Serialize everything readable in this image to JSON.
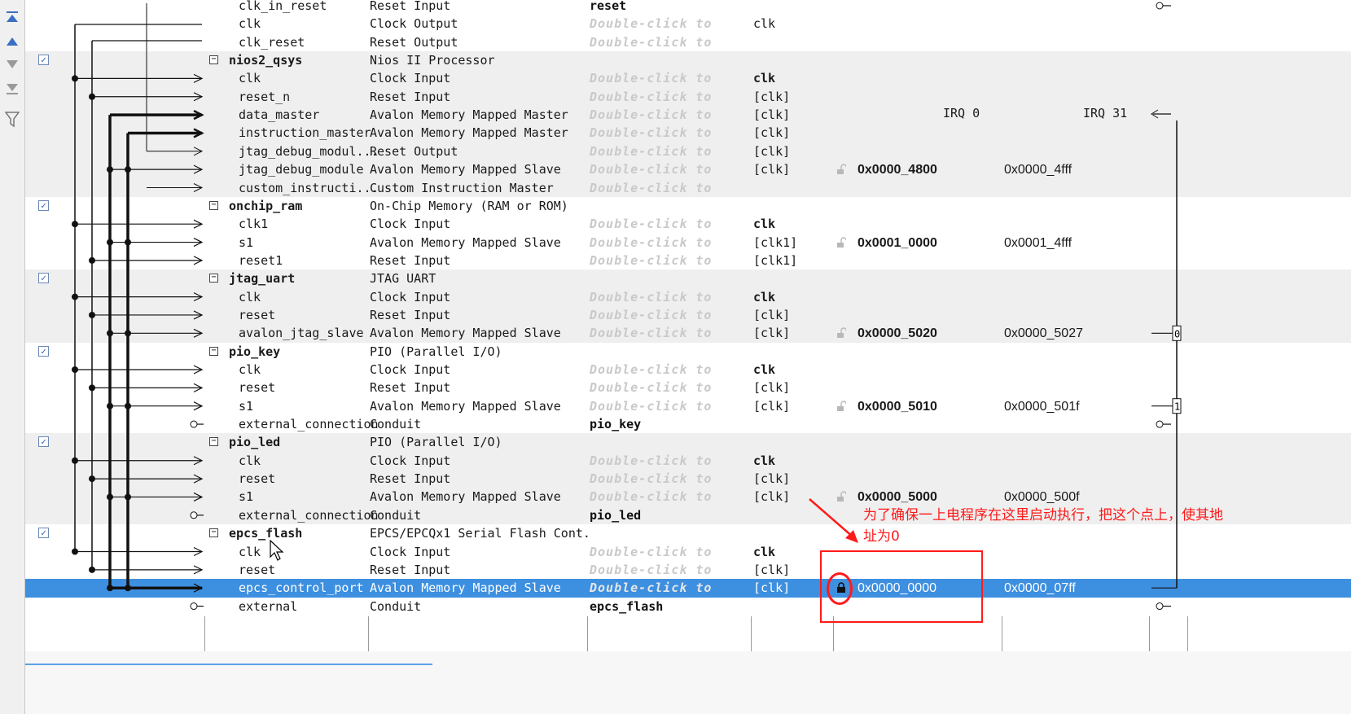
{
  "toolbar": {
    "buttons": [
      {
        "icon": "move-to-top-icon"
      },
      {
        "icon": "move-up-icon"
      },
      {
        "icon": "move-down-icon"
      },
      {
        "icon": "move-to-bottom-icon"
      },
      {
        "icon": "filter-icon"
      }
    ]
  },
  "irq": {
    "label_start": "IRQ 0",
    "label_end": "IRQ 31"
  },
  "rows": [
    {
      "name": "clk_in_reset",
      "desc": "Reset Input",
      "export": "reset",
      "export_set": true,
      "clock": "",
      "base": "",
      "end": ""
    },
    {
      "name": "clk",
      "desc": "Clock Output",
      "export": "Double-click to",
      "clock": "clk",
      "base": "",
      "end": ""
    },
    {
      "name": "clk_reset",
      "desc": "Reset Output",
      "export": "Double-click to",
      "clock": "",
      "base": "",
      "end": ""
    },
    {
      "name": "nios2_qsys",
      "desc": "Nios II Processor",
      "export": "",
      "clock": "",
      "base": "",
      "end": "",
      "component": true,
      "checked": "✓"
    },
    {
      "name": "clk",
      "desc": "Clock Input",
      "export": "Double-click to",
      "clock": "clk",
      "clock_bold": true,
      "base": "",
      "end": ""
    },
    {
      "name": "reset_n",
      "desc": "Reset Input",
      "export": "Double-click to",
      "clock": "[clk]",
      "base": "",
      "end": ""
    },
    {
      "name": "data_master",
      "desc": "Avalon Memory Mapped Master",
      "export": "Double-click to",
      "clock": "[clk]",
      "base": "",
      "end": ""
    },
    {
      "name": "instruction_master",
      "desc": "Avalon Memory Mapped Master",
      "export": "Double-click to",
      "clock": "[clk]",
      "base": "",
      "end": ""
    },
    {
      "name": "jtag_debug_modul...",
      "desc": "Reset Output",
      "export": "Double-click to",
      "clock": "[clk]",
      "base": "",
      "end": ""
    },
    {
      "name": "jtag_debug_module",
      "desc": "Avalon Memory Mapped Slave",
      "export": "Double-click to",
      "clock": "[clk]",
      "base": "0x0000_4800",
      "end": "0x0000_4fff",
      "lock": "open"
    },
    {
      "name": "custom_instructi...",
      "desc": "Custom Instruction Master",
      "export": "Double-click to",
      "clock": "",
      "base": "",
      "end": ""
    },
    {
      "name": "onchip_ram",
      "desc": "On-Chip Memory (RAM or ROM)",
      "export": "",
      "clock": "",
      "base": "",
      "end": "",
      "component": true,
      "checked": "✓"
    },
    {
      "name": "clk1",
      "desc": "Clock Input",
      "export": "Double-click to",
      "clock": "clk",
      "clock_bold": true,
      "base": "",
      "end": ""
    },
    {
      "name": "s1",
      "desc": "Avalon Memory Mapped Slave",
      "export": "Double-click to",
      "clock": "[clk1]",
      "base": "0x0001_0000",
      "end": "0x0001_4fff",
      "lock": "open"
    },
    {
      "name": "reset1",
      "desc": "Reset Input",
      "export": "Double-click to",
      "clock": "[clk1]",
      "base": "",
      "end": ""
    },
    {
      "name": "jtag_uart",
      "desc": "JTAG UART",
      "export": "",
      "clock": "",
      "base": "",
      "end": "",
      "component": true,
      "checked": "✓"
    },
    {
      "name": "clk",
      "desc": "Clock Input",
      "export": "Double-click to",
      "clock": "clk",
      "clock_bold": true,
      "base": "",
      "end": ""
    },
    {
      "name": "reset",
      "desc": "Reset Input",
      "export": "Double-click to",
      "clock": "[clk]",
      "base": "",
      "end": ""
    },
    {
      "name": "avalon_jtag_slave",
      "desc": "Avalon Memory Mapped Slave",
      "export": "Double-click to",
      "clock": "[clk]",
      "base": "0x0000_5020",
      "end": "0x0000_5027",
      "lock": "open",
      "irq": "0"
    },
    {
      "name": "pio_key",
      "desc": "PIO (Parallel I/O)",
      "export": "",
      "clock": "",
      "base": "",
      "end": "",
      "component": true,
      "checked": "✓"
    },
    {
      "name": "clk",
      "desc": "Clock Input",
      "export": "Double-click to",
      "clock": "clk",
      "clock_bold": true,
      "base": "",
      "end": ""
    },
    {
      "name": "reset",
      "desc": "Reset Input",
      "export": "Double-click to",
      "clock": "[clk]",
      "base": "",
      "end": ""
    },
    {
      "name": "s1",
      "desc": "Avalon Memory Mapped Slave",
      "export": "Double-click to",
      "clock": "[clk]",
      "base": "0x0000_5010",
      "end": "0x0000_501f",
      "lock": "open",
      "irq": "1"
    },
    {
      "name": "external_connection",
      "desc": "Conduit",
      "export": "pio_key",
      "export_set": true,
      "clock": "",
      "base": "",
      "end": ""
    },
    {
      "name": "pio_led",
      "desc": "PIO (Parallel I/O)",
      "export": "",
      "clock": "",
      "base": "",
      "end": "",
      "component": true,
      "checked": "✓"
    },
    {
      "name": "clk",
      "desc": "Clock Input",
      "export": "Double-click to",
      "clock": "clk",
      "clock_bold": true,
      "base": "",
      "end": ""
    },
    {
      "name": "reset",
      "desc": "Reset Input",
      "export": "Double-click to",
      "clock": "[clk]",
      "base": "",
      "end": ""
    },
    {
      "name": "s1",
      "desc": "Avalon Memory Mapped Slave",
      "export": "Double-click to",
      "clock": "[clk]",
      "base": "0x0000_5000",
      "end": "0x0000_500f",
      "lock": "open"
    },
    {
      "name": "external_connection",
      "desc": "Conduit",
      "export": "pio_led",
      "export_set": true,
      "clock": "",
      "base": "",
      "end": ""
    },
    {
      "name": "epcs_flash",
      "desc": "EPCS/EPCQx1 Serial Flash Cont...",
      "export": "",
      "clock": "",
      "base": "",
      "end": "",
      "component": true,
      "checked": "✓"
    },
    {
      "name": "clk",
      "desc": "Clock Input",
      "export": "Double-click to",
      "clock": "clk",
      "clock_bold": true,
      "base": "",
      "end": ""
    },
    {
      "name": "reset",
      "desc": "Reset Input",
      "export": "Double-click to",
      "clock": "[clk]",
      "base": "",
      "end": ""
    },
    {
      "name": "epcs_control_port",
      "desc": "Avalon Memory Mapped Slave",
      "export": "Double-click to",
      "clock": "[clk]",
      "base": "0x0000_0000",
      "end": "0x0000_07ff",
      "lock": "closed",
      "selected": true
    },
    {
      "name": "external",
      "desc": "Conduit",
      "export": "epcs_flash",
      "export_set": true,
      "clock": "",
      "base": "",
      "end": ""
    }
  ],
  "annotation": {
    "text_line1": "为了确保一上电程序在这里启动执行，把这个点上，使其地",
    "text_line2": "址为0",
    "color": "#ff1a1a"
  },
  "colors": {
    "selection": "#3d8fe0",
    "shade": "#efefef",
    "annotation": "#ff1a1a"
  }
}
